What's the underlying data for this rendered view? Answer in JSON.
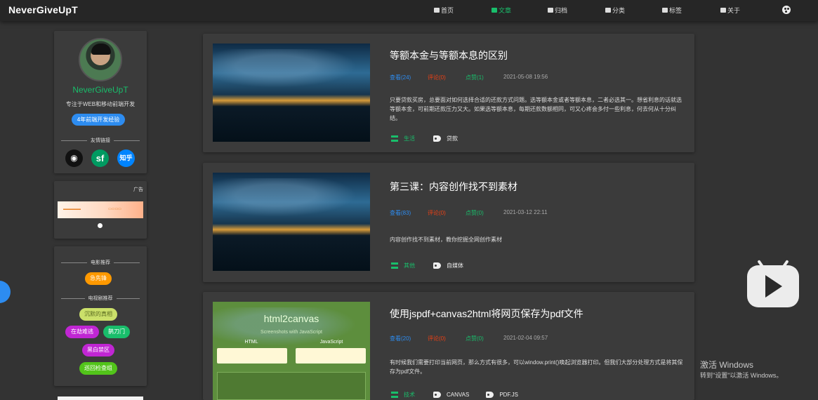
{
  "brand": "NeverGiveUpT",
  "nav": [
    {
      "label": "首页",
      "icon": "home-icon",
      "active": false
    },
    {
      "label": "文章",
      "icon": "document-icon",
      "active": true
    },
    {
      "label": "归档",
      "icon": "archive-icon",
      "active": false
    },
    {
      "label": "分类",
      "icon": "category-icon",
      "active": false
    },
    {
      "label": "标签",
      "icon": "tag-icon",
      "active": false
    },
    {
      "label": "关于",
      "icon": "user-icon",
      "active": false
    }
  ],
  "profile": {
    "name": "NeverGiveUpT",
    "desc": "专注于WEB和移动前端开发",
    "badge": "4年前端开发经验",
    "links_title": "友情链接",
    "links": [
      {
        "label": "",
        "icon": "github-icon"
      },
      {
        "label": "sf",
        "icon": "segmentfault-icon"
      },
      {
        "label": "知乎",
        "icon": "zhihu-icon"
      }
    ]
  },
  "ad": {
    "label": "广告"
  },
  "recs": {
    "movie_title": "电影推荐",
    "movies": [
      "急先锋"
    ],
    "tv_title": "电视剧推荐",
    "tv": [
      "沉默的真相",
      "在劫难逃",
      "鹊刀门",
      "黑白禁区",
      "巡回检查组"
    ]
  },
  "articles": [
    {
      "title": "等额本金与等额本息的区别",
      "views": "查看(24)",
      "comments": "评论(0)",
      "likes": "点赞(1)",
      "date": "2021-05-08 19:56",
      "summary": "只要贷款买房，总要面对如何选择合适的还款方式问题。选等额本金或者等额本息，二者必选其一。想省利息的话就选等额本金，可前期还款压力又大。如果选等额本息，每期还款数额相同，可又心疼会多付一些利息，何去何从十分纠结。",
      "category": "生活",
      "tags": [
        "贷款"
      ]
    },
    {
      "title": "第三课：内容创作找不到素材",
      "views": "查看(83)",
      "comments": "评论(0)",
      "likes": "点赞(0)",
      "date": "2021-03-12 22:11",
      "summary": "内容创作找不到素材，教你挖掘全网创作素材",
      "category": "其他",
      "tags": [
        "自媒体"
      ]
    },
    {
      "title": "使用jspdf+canvas2html将网页保存为pdf文件",
      "views": "查看(20)",
      "comments": "评论(0)",
      "likes": "点赞(0)",
      "date": "2021-02-04 09:57",
      "summary": "有时候我们需要打印当前网页，那么方式有很多，可以window.print()唤起浏览器打印。但我们大部分处理方式是将其保存为pdf文件。",
      "category": "技术",
      "tags": [
        "CANVAS",
        "PDF.JS"
      ],
      "thumb": {
        "title": "html2canvas",
        "subtitle": "Screenshots with JavaScript",
        "col1": "HTML",
        "col2": "JavaScript"
      }
    }
  ],
  "watermark": {
    "line1": "激活 Windows",
    "line2": "转到\"设置\"以激活 Windows。"
  }
}
